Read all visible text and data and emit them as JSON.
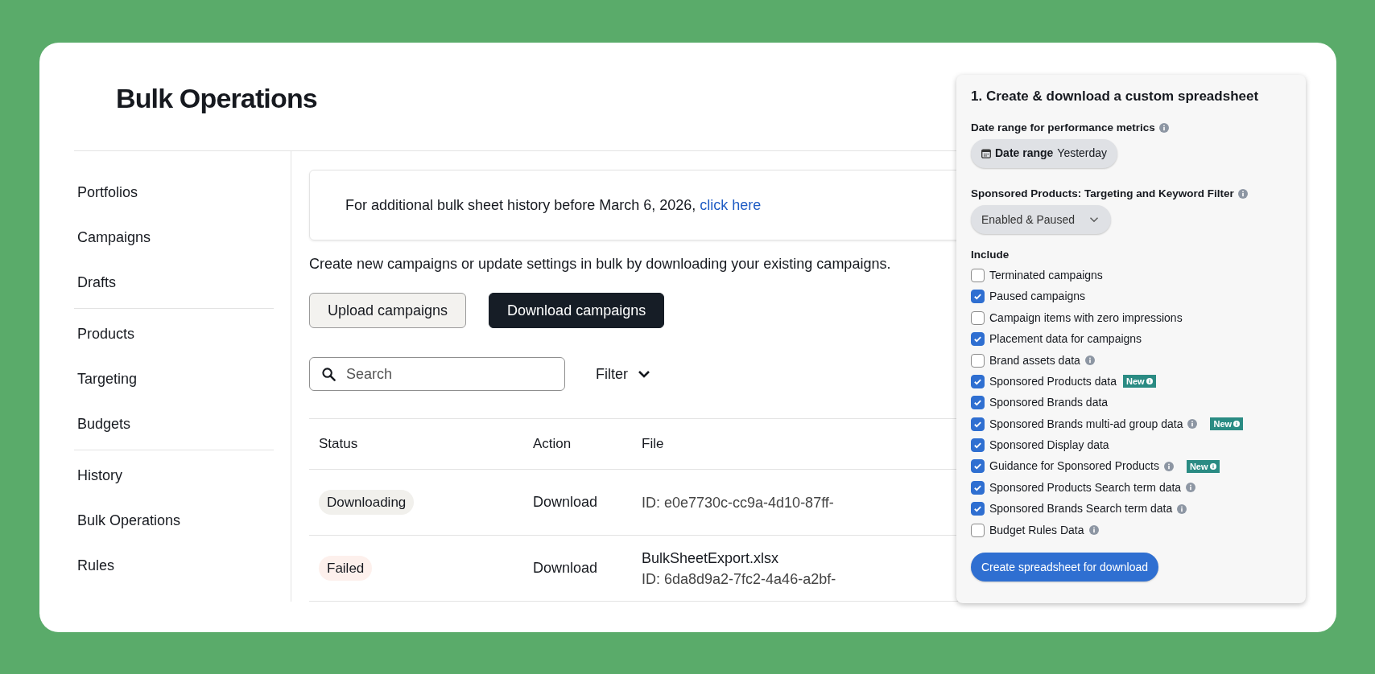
{
  "title": "Bulk Operations",
  "sidebar": {
    "sections": [
      {
        "items": [
          "Portfolios",
          "Campaigns",
          "Drafts"
        ]
      },
      {
        "items": [
          "Products",
          "Targeting",
          "Budgets"
        ]
      },
      {
        "items": [
          "History",
          "Bulk Operations",
          "Rules"
        ]
      }
    ]
  },
  "notice": {
    "text": "For additional bulk sheet history before March 6, 2026,",
    "link": "click here"
  },
  "description": "Create new campaigns or update settings in bulk by downloading your existing campaigns.",
  "buttons": [
    {
      "label": "Upload campaigns",
      "kind": "secondary"
    },
    {
      "label": "Download campaigns",
      "kind": "primary"
    }
  ],
  "search": {
    "placeholder": "Search"
  },
  "filter": {
    "label": "Filter"
  },
  "table": {
    "columns": [
      "Status",
      "Action",
      "File"
    ],
    "rows": [
      {
        "status": {
          "label": "Downloading",
          "color": "#f1f0ec"
        },
        "action": "Download",
        "file": [
          "ID: e0e7730c-cc9a-4d10-87ff-"
        ]
      },
      {
        "status": {
          "label": "Failed",
          "color": "#fdf0ec"
        },
        "action": "Download",
        "file": [
          "BulkSheetExport.xlsx",
          "ID: 6da8d9a2-7fc2-4a46-a2bf-"
        ]
      }
    ]
  },
  "panel": {
    "title": "1. Create & download a custom spreadsheet",
    "date_range": {
      "label": "Date range for performance metrics",
      "info": true,
      "chip_label": "Date range",
      "chip_value": "Yesterday"
    },
    "filter": {
      "label": "Sponsored Products: Targeting and Keyword Filter",
      "info": true,
      "value": "Enabled & Paused"
    },
    "include": {
      "label": "Include",
      "items": [
        {
          "label": "Terminated campaigns",
          "checked": false,
          "info": false
        },
        {
          "label": "Paused campaigns",
          "checked": true,
          "info": false
        },
        {
          "label": "Campaign items with zero impressions",
          "checked": false,
          "info": false
        },
        {
          "label": "Placement data for campaigns",
          "checked": true,
          "info": false
        },
        {
          "label": "Brand assets data",
          "checked": false,
          "info": true
        },
        {
          "label": "Sponsored Products data",
          "checked": true,
          "info": false,
          "badge": "New"
        },
        {
          "label": "Sponsored Brands data",
          "checked": true,
          "info": false
        },
        {
          "label": "Sponsored Brands multi-ad group data",
          "checked": true,
          "info": true,
          "badge": "New"
        },
        {
          "label": "Sponsored Display data",
          "checked": true,
          "info": false
        },
        {
          "label": "Guidance for Sponsored Products",
          "checked": true,
          "info": true,
          "badge": "New"
        },
        {
          "label": "Sponsored Products Search term data",
          "checked": true,
          "info": true
        },
        {
          "label": "Sponsored Brands Search term data",
          "checked": true,
          "info": true
        },
        {
          "label": "Budget Rules Data",
          "checked": false,
          "info": true
        }
      ]
    },
    "button": "Create spreadsheet for download"
  }
}
